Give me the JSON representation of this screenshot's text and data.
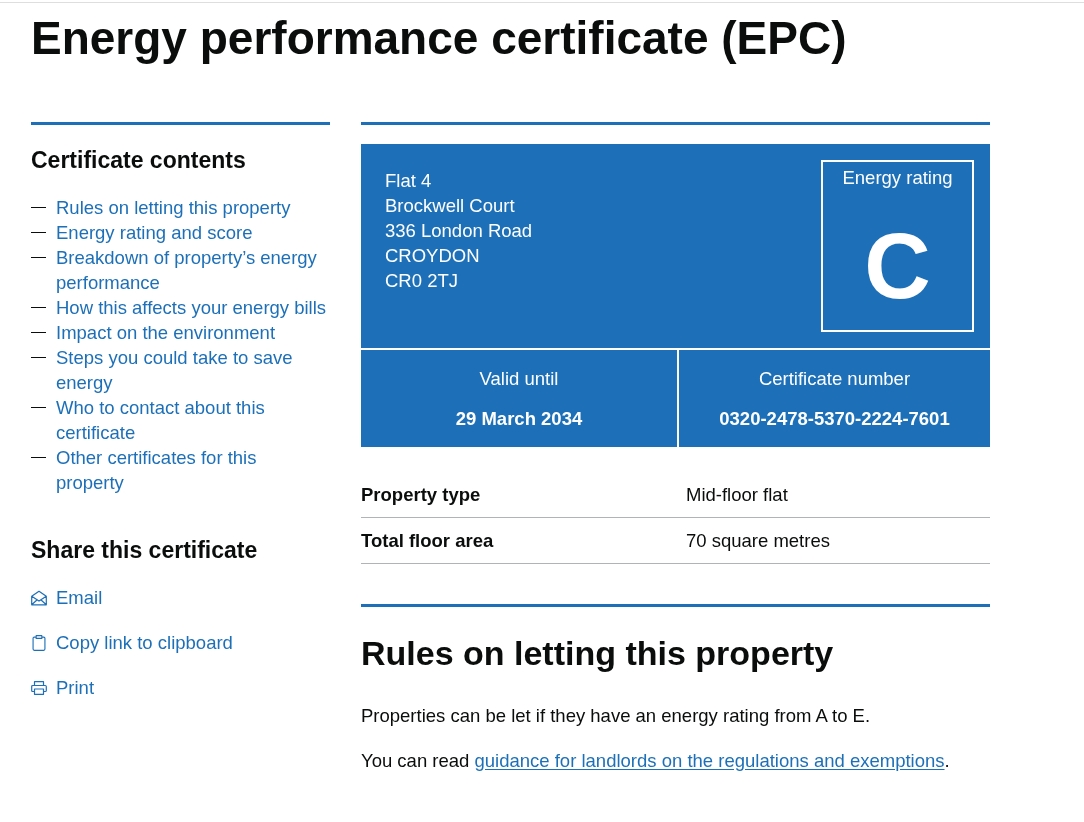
{
  "page_title": "Energy performance certificate (EPC)",
  "sidebar": {
    "contents": {
      "heading": "Certificate contents",
      "links": [
        "Rules on letting this property",
        "Energy rating and score",
        "Breakdown of property’s energy performance",
        "How this affects your energy bills",
        "Impact on the environment",
        "Steps you could take to save energy",
        "Who to contact about this certificate",
        "Other certificates for this property"
      ]
    },
    "share": {
      "heading": "Share this certificate",
      "links": [
        {
          "kind": "email",
          "label": "Email"
        },
        {
          "kind": "clipboard",
          "label": "Copy link to clipboard"
        },
        {
          "kind": "print",
          "label": "Print"
        }
      ]
    }
  },
  "summary": {
    "address_lines": [
      "Flat 4",
      "Brockwell Court",
      "336 London Road",
      "CROYDON",
      "CR0 2TJ"
    ],
    "rating": {
      "label": "Energy rating",
      "value": "C"
    },
    "fields": [
      {
        "label": "Valid until",
        "value": "29 March 2034"
      },
      {
        "label": "Certificate number",
        "value": "0320-2478-5370-2224-7601"
      }
    ]
  },
  "property_details": [
    {
      "key": "Property type",
      "value": "Mid-floor flat"
    },
    {
      "key": "Total floor area",
      "value": "70 square metres"
    }
  ],
  "section": {
    "heading": "Rules on letting this property",
    "paragraphs": [
      {
        "text": "Properties can be let if they have an energy rating from A to E."
      },
      {
        "text": "You can read ",
        "link": "guidance for landlords on the regulations and exemptions",
        "after": "."
      }
    ]
  }
}
